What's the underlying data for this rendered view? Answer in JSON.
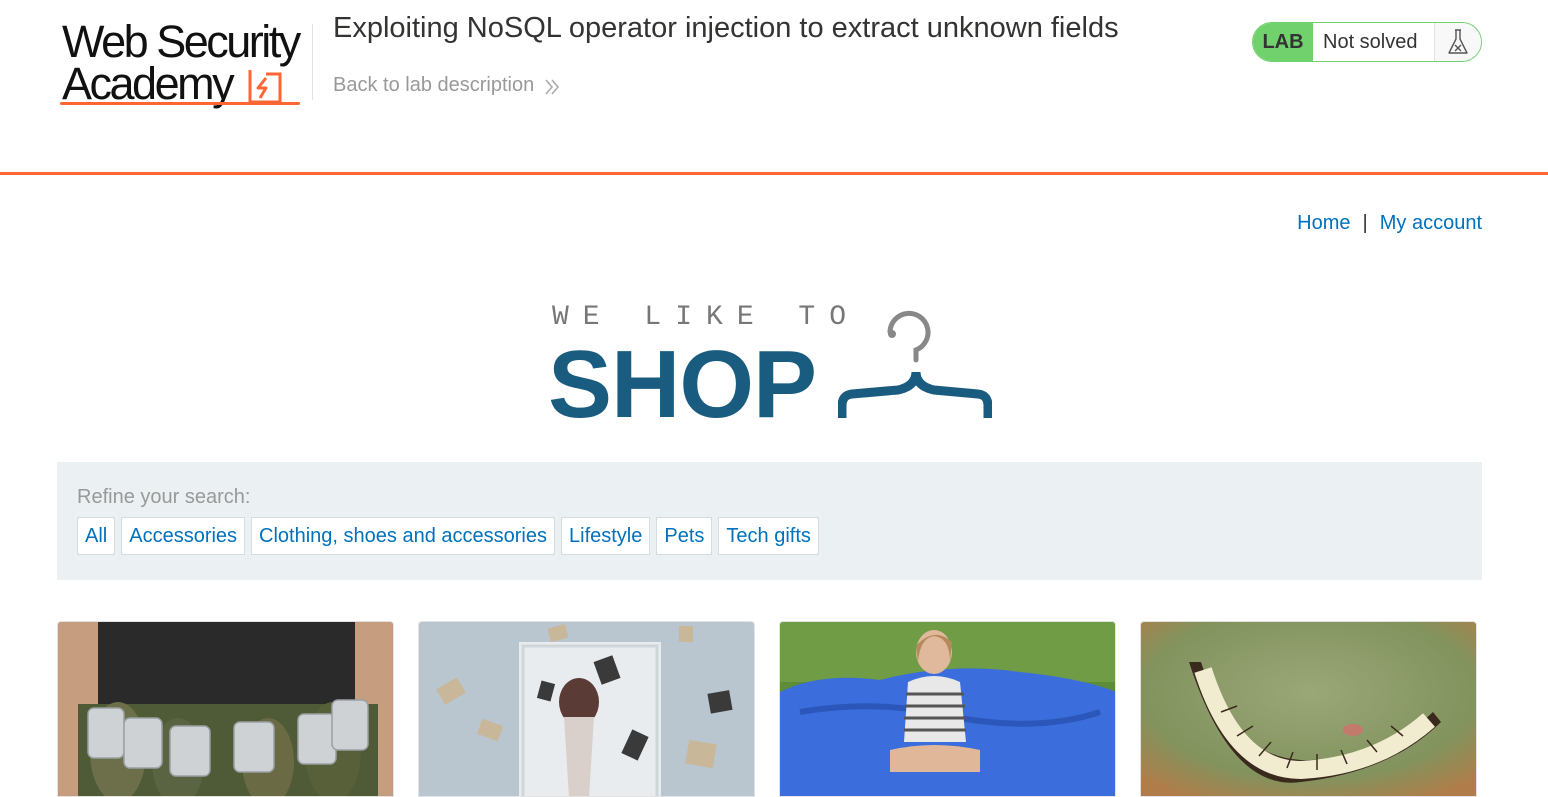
{
  "logo": {
    "line1": "Web Security",
    "line2": "Academy"
  },
  "header": {
    "title": "Exploiting NoSQL operator injection to extract unknown fields",
    "back_link": "Back to lab description"
  },
  "lab": {
    "badge": "LAB",
    "status": "Not solved"
  },
  "nav": {
    "home": "Home",
    "separator": "|",
    "my_account": "My account"
  },
  "shop_logo": {
    "tagline": "WE LIKE TO",
    "word": "SHOP"
  },
  "filter": {
    "label": "Refine your search:",
    "categories": [
      "All",
      "Accessories",
      "Clothing, shoes and accessories",
      "Lifestyle",
      "Pets",
      "Tech gifts"
    ]
  },
  "colors": {
    "accent": "#ff6633",
    "link": "#0071bc",
    "lab_green": "#70d16d",
    "shop_blue": "#1a5c80"
  }
}
